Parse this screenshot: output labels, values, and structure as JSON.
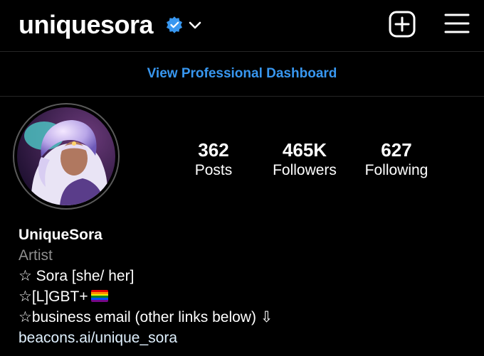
{
  "header": {
    "username": "uniquesora"
  },
  "dashboard": {
    "label": "View Professional Dashboard"
  },
  "stats": [
    {
      "value": "362",
      "label": "Posts"
    },
    {
      "value": "465K",
      "label": "Followers"
    },
    {
      "value": "627",
      "label": "Following"
    }
  ],
  "bio": {
    "name": "UniqueSora",
    "category": "Artist",
    "line1": "☆ Sora [she/ her]",
    "line2": "☆[L]GBT+",
    "line3": "☆business email (other links below) ⇩",
    "link": "beacons.ai/unique_sora"
  },
  "colors": {
    "accent": "#3897f0",
    "background": "#000000",
    "verified": "#3897f0"
  },
  "icons": [
    "verified-badge-icon",
    "chevron-down-icon",
    "new-post-plus-icon",
    "menu-hamburger-icon",
    "pride-flag-icon"
  ]
}
